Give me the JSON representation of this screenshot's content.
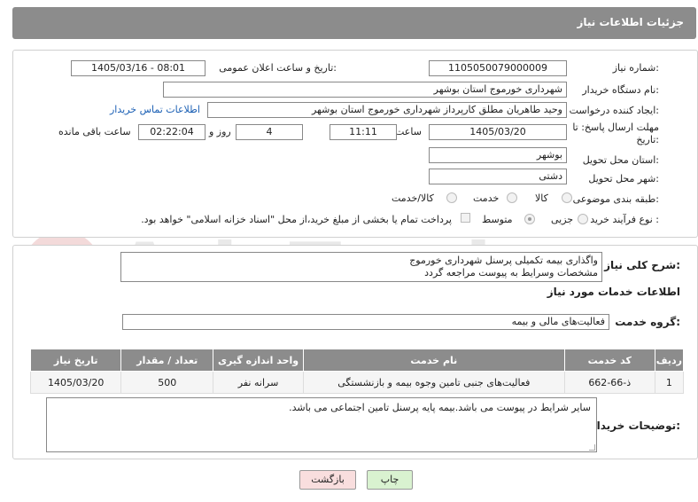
{
  "header": {
    "title": "جزئیات اطلاعات نیاز"
  },
  "fields": {
    "need_number_label": "شماره نیاز:",
    "need_number": "1105050079000009",
    "announce_label": "تاریخ و ساعت اعلان عمومی:",
    "announce_value": "1405/03/16 - 08:01",
    "buyer_org_label": "نام دستگاه خریدار:",
    "buyer_org": "شهرداری خورموج استان بوشهر",
    "creator_label": "ایجاد کننده درخواست:",
    "creator": "وحید طاهریان مطلق کارپرداز شهرداری خورموج استان بوشهر",
    "contact_link": "اطلاعات تماس خریدار",
    "deadline_label_1": "مهلت ارسال پاسخ: تا",
    "deadline_label_2": "تاریخ:",
    "deadline_date": "1405/03/20",
    "time_label": "ساعت",
    "deadline_time": "11:11",
    "days": "4",
    "days_label": "روز و",
    "remaining_time": "02:22:04",
    "remaining_label": "ساعت باقی مانده",
    "province_label": "استان محل تحویل:",
    "province": "بوشهر",
    "city_label": "شهر محل تحویل:",
    "city": "دشتی",
    "category_label": "طبقه بندی موضوعی:",
    "category_options": [
      "کالا",
      "خدمت",
      "کالا/خدمت"
    ],
    "category_selected": "خدمت",
    "process_label": "نوع فرآیند خرید :",
    "process_options": [
      "جزیی",
      "متوسط"
    ],
    "process_selected": "متوسط",
    "payment_note": "پرداخت تمام یا بخشی از مبلغ خرید،از محل \"اسناد خزانه اسلامی\" خواهد بود."
  },
  "summary": {
    "label": "شرح کلی نیاز:",
    "line1": "واگذاری بیمه تکمیلی پرسنل شهرداری خورموج",
    "line2": "مشخصات وسرایط به پیوست مراجعه گردد"
  },
  "services": {
    "section_title": "اطلاعات خدمات مورد نیاز",
    "group_label": "گروه خدمت:",
    "group_value": "فعالیت‌های مالی و بیمه",
    "columns": [
      "ردیف",
      "کد خدمت",
      "نام خدمت",
      "واحد اندازه گیری",
      "تعداد / مقدار",
      "تاریخ نیاز"
    ],
    "rows": [
      [
        "1",
        "ذ-66-662",
        "فعالیت‌های جنبی تامین وجوه بیمه و بازنشستگی",
        "سرانه نفر",
        "500",
        "1405/03/20"
      ]
    ]
  },
  "buyer_notes": {
    "label": "توضیحات خریدار:",
    "text": "سایر شرایط در پیوست می باشد.بیمه پایه پرسنل تامین اجتماعی می باشد."
  },
  "buttons": {
    "print": "چاپ",
    "back": "بازگشت"
  },
  "watermark": {
    "text": "AriaTender.neT"
  },
  "colors": {
    "header_bg": "#8c8c8c",
    "link": "#1a5fb4",
    "print_btn": "#d9f2d0",
    "back_btn": "#f9dede"
  }
}
